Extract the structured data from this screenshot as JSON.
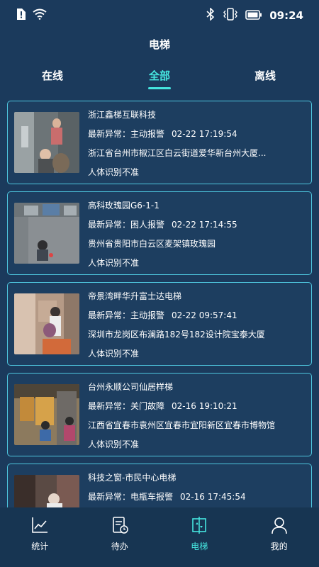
{
  "status_bar": {
    "time": "09:24",
    "left_icons": [
      "alert-icon",
      "wifi-icon"
    ],
    "right_icons": [
      "bluetooth-icon",
      "vibrate-icon",
      "battery-icon"
    ]
  },
  "header": {
    "title": "电梯"
  },
  "tabs": [
    {
      "label": "在线",
      "active": false
    },
    {
      "label": "全部",
      "active": true
    },
    {
      "label": "离线",
      "active": false
    }
  ],
  "colors": {
    "accent": "#46e6e0",
    "background": "#1b3a5c",
    "card_border": "#4ec6de"
  },
  "elevators": [
    {
      "name": "浙江鑫梯互联科技",
      "alarm_label": "最新异常：",
      "alarm_type": "主动报警",
      "alarm_time": "02-22 17:19:54",
      "address": "浙江省台州市椒江区白云街道爱华新台州大厦...",
      "recognition": "人体识别不准"
    },
    {
      "name": "高科玫瑰园G6-1-1",
      "alarm_label": "最新异常：",
      "alarm_type": "困人报警",
      "alarm_time": "02-22 17:14:55",
      "address": "贵州省贵阳市白云区麦架镇玫瑰园",
      "recognition": "人体识别不准"
    },
    {
      "name": "帝景湾畔华升富士达电梯",
      "alarm_label": "最新异常：",
      "alarm_type": "主动报警",
      "alarm_time": "02-22 09:57:41",
      "address": "深圳市龙岗区布澜路182号182设计院宝泰大厦",
      "recognition": "人体识别不准"
    },
    {
      "name": "台州永顺公司仙居样梯",
      "alarm_label": "最新异常：",
      "alarm_type": "关门故障",
      "alarm_time": "02-16 19:10:21",
      "address": " 江西省宜春市袁州区宜春市宜阳新区宜春市博物馆",
      "recognition": "人体识别不准"
    },
    {
      "name": "科技之窗-市民中心电梯",
      "alarm_label": "最新异常：",
      "alarm_type": "电瓶车报警",
      "alarm_time": "02-16 17:45:54",
      "address": "",
      "recognition": ""
    }
  ],
  "bottom_nav": [
    {
      "label": "统计",
      "icon": "chart-icon",
      "active": false
    },
    {
      "label": "待办",
      "icon": "todo-icon",
      "active": false
    },
    {
      "label": "电梯",
      "icon": "elevator-icon",
      "active": true
    },
    {
      "label": "我的",
      "icon": "user-icon",
      "active": false
    }
  ]
}
